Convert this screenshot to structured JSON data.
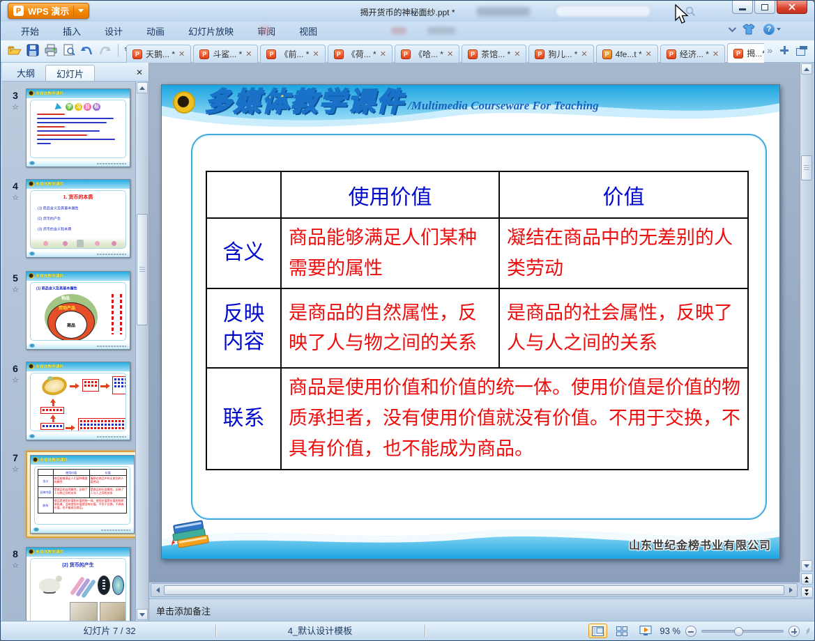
{
  "colors": {
    "accent_orange": "#f18500",
    "brand_cyan": "#29abe2",
    "table_blue": "#0008cc",
    "table_red": "#ee0d0d",
    "close_red": "#da3f2b",
    "selection_orange": "#dd9e33"
  },
  "titlebar": {
    "app_button_label": "WPS 演示",
    "document_title": "揭开货币的神秘面纱.ppt *"
  },
  "menubar": {
    "items": [
      "开始",
      "插入",
      "设计",
      "动画",
      "幻灯片放映",
      "审阅",
      "视图"
    ]
  },
  "doc_tabs": [
    {
      "label": "天鹅... *"
    },
    {
      "label": "斗鲨... *"
    },
    {
      "label": "《前... *"
    },
    {
      "label": "《荷... *"
    },
    {
      "label": "《哈... *"
    },
    {
      "label": "茶馆... *"
    },
    {
      "label": "狗儿... *"
    },
    {
      "label": "4fe...t *"
    },
    {
      "label": "经济... *"
    },
    {
      "label": "揭...*"
    }
  ],
  "panel_tabs": {
    "outline": "大纲",
    "slides": "幻灯片"
  },
  "thumbnails": {
    "t3": {
      "num": "3",
      "title_chars": [
        "学",
        "习",
        "目",
        "标"
      ]
    },
    "t4": {
      "num": "4",
      "title": "1. 货币的本质",
      "lines": [
        "(1) 商品含义及其基本属性",
        "(2) 货币的产生",
        "(3) 货币的含义和本质"
      ]
    },
    "t5": {
      "num": "5",
      "title": "(1) 商品含义及其基本属性",
      "ring_outer": "物品",
      "ring_mid": "劳动产品",
      "ring_inner": "商品"
    },
    "t6": {
      "num": "6"
    },
    "t7": {
      "num": "7"
    },
    "t8": {
      "num": "8",
      "title": "(2) 货币的产生"
    }
  },
  "slide": {
    "header_title_cn": "多媒体教学课件",
    "header_title_en": "/Multimedia Courseware For Teaching",
    "footer_company": "山东世纪金榜书业有限公司",
    "table": {
      "col1_header": "使用价值",
      "col2_header": "价值",
      "row1_label": "含义",
      "row1_cell1": "商品能够满足人们某种需要的属性",
      "row1_cell2": "凝结在商品中的无差别的人类劳动",
      "row2_label": "反映内容",
      "row2_cell1": "是商品的自然属性，反映了人与物之间的关系",
      "row2_cell2": "是商品的社会属性，反映了人与人之间的关系",
      "row3_label": "联系",
      "row3_cell": "商品是使用价值和价值的统一体。使用价值是价值的物质承担者，没有使用价值就没有价值。不用于交换，不具有价值，也不能成为商品。"
    }
  },
  "notes": {
    "placeholder": "单击添加备注"
  },
  "statusbar": {
    "slide_indicator": "幻灯片 7 / 32",
    "template_name": "4_默认设计模板",
    "zoom_level": "93 %"
  }
}
